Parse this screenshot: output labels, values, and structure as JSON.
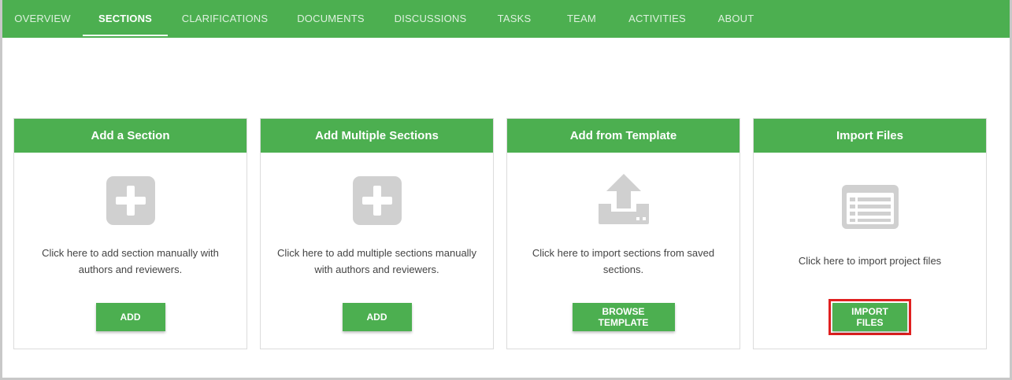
{
  "nav": {
    "tabs": [
      {
        "label": "OVERVIEW"
      },
      {
        "label": "SECTIONS"
      },
      {
        "label": "CLARIFICATIONS"
      },
      {
        "label": "DOCUMENTS"
      },
      {
        "label": "DISCUSSIONS"
      },
      {
        "label": "TASKS"
      },
      {
        "label": "TEAM"
      },
      {
        "label": "ACTIVITIES"
      },
      {
        "label": "ABOUT"
      }
    ],
    "active": "SECTIONS"
  },
  "cards": [
    {
      "title": "Add a Section",
      "icon": "plus-icon",
      "description": "Click here to add section manually with authors and reviewers.",
      "button": "ADD"
    },
    {
      "title": "Add Multiple Sections",
      "icon": "plus-icon",
      "description": "Click here to add multiple sections manually with authors and reviewers.",
      "button": "ADD"
    },
    {
      "title": "Add from Template",
      "icon": "upload-tray-icon",
      "description": "Click here to import sections from saved sections.",
      "button": "BROWSE TEMPLATE"
    },
    {
      "title": "Import Files",
      "icon": "file-list-icon",
      "description": "Click here to import project files",
      "button": "IMPORT FILES"
    }
  ],
  "colors": {
    "accent": "#4caf50",
    "icon": "#d0d0d0",
    "highlight": "#e02020"
  }
}
